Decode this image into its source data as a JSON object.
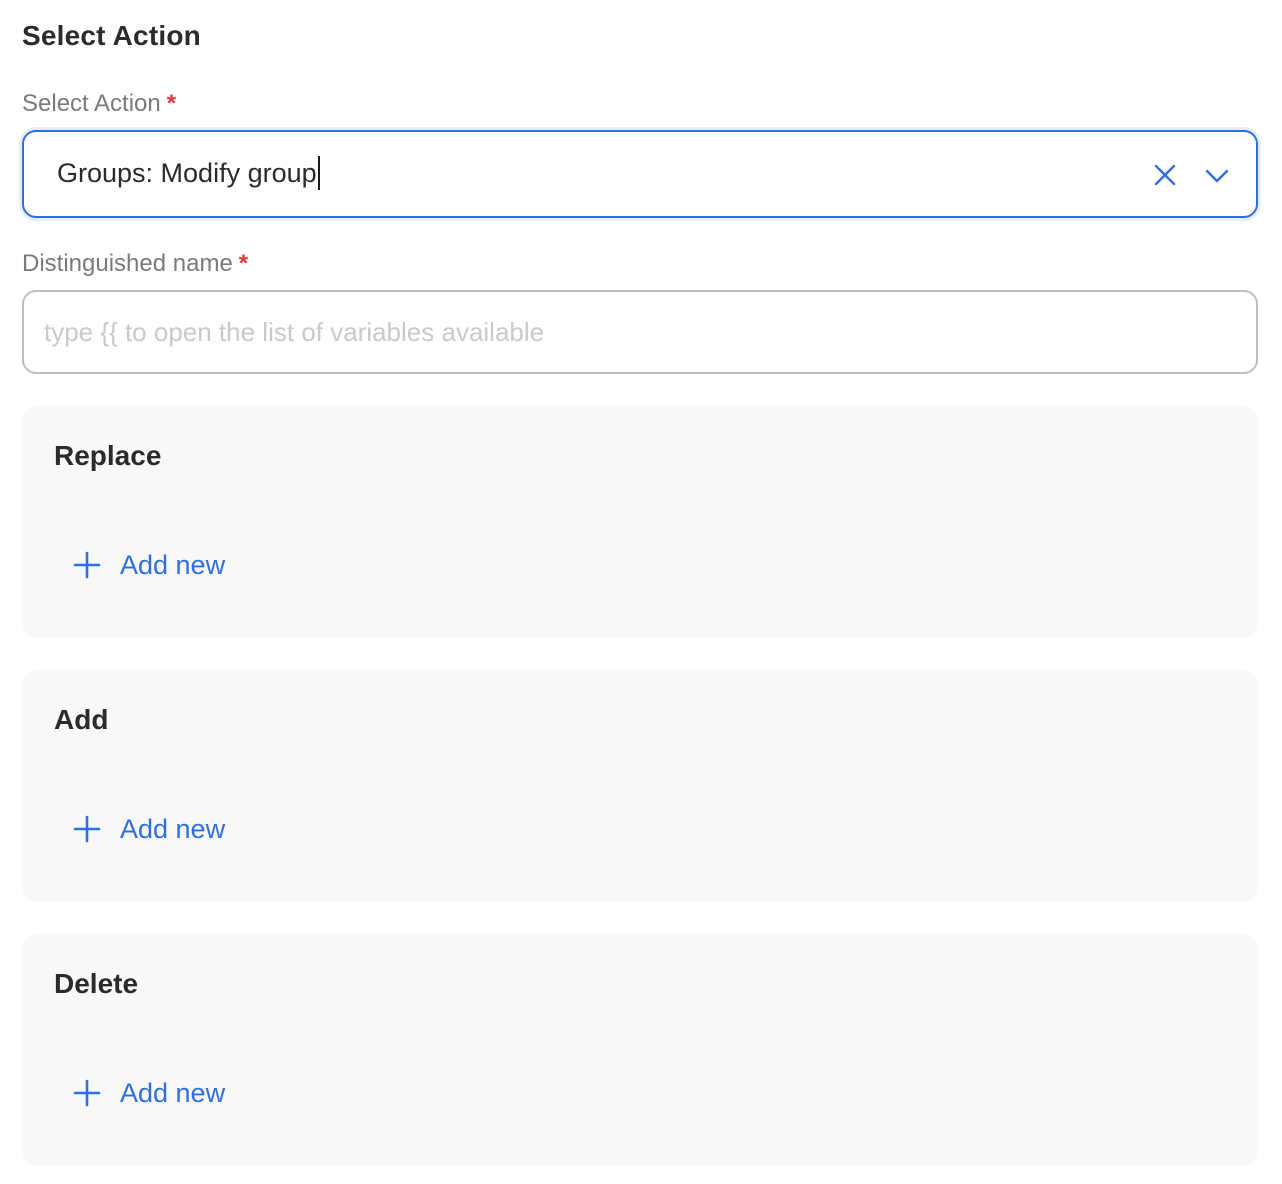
{
  "header": {
    "title": "Select Action"
  },
  "select_action": {
    "label": "Select Action",
    "required_mark": "*",
    "value": "Groups: Modify group",
    "clear_icon": "close-icon",
    "dropdown_icon": "chevron-down-icon"
  },
  "distinguished_name": {
    "label": "Distinguished name",
    "required_mark": "*",
    "value": "",
    "placeholder": "type {{ to open the list of variables available"
  },
  "panels": [
    {
      "title": "Replace",
      "add_label": "Add new",
      "add_icon": "plus-icon"
    },
    {
      "title": "Add",
      "add_label": "Add new",
      "add_icon": "plus-icon"
    },
    {
      "title": "Delete",
      "add_label": "Add new",
      "add_icon": "plus-icon"
    }
  ],
  "colors": {
    "accent": "#2f6fe0",
    "required": "#e03a3a",
    "panel_bg": "#f8f8f8",
    "label": "#7a7a7a",
    "placeholder": "#c9c9c9"
  }
}
